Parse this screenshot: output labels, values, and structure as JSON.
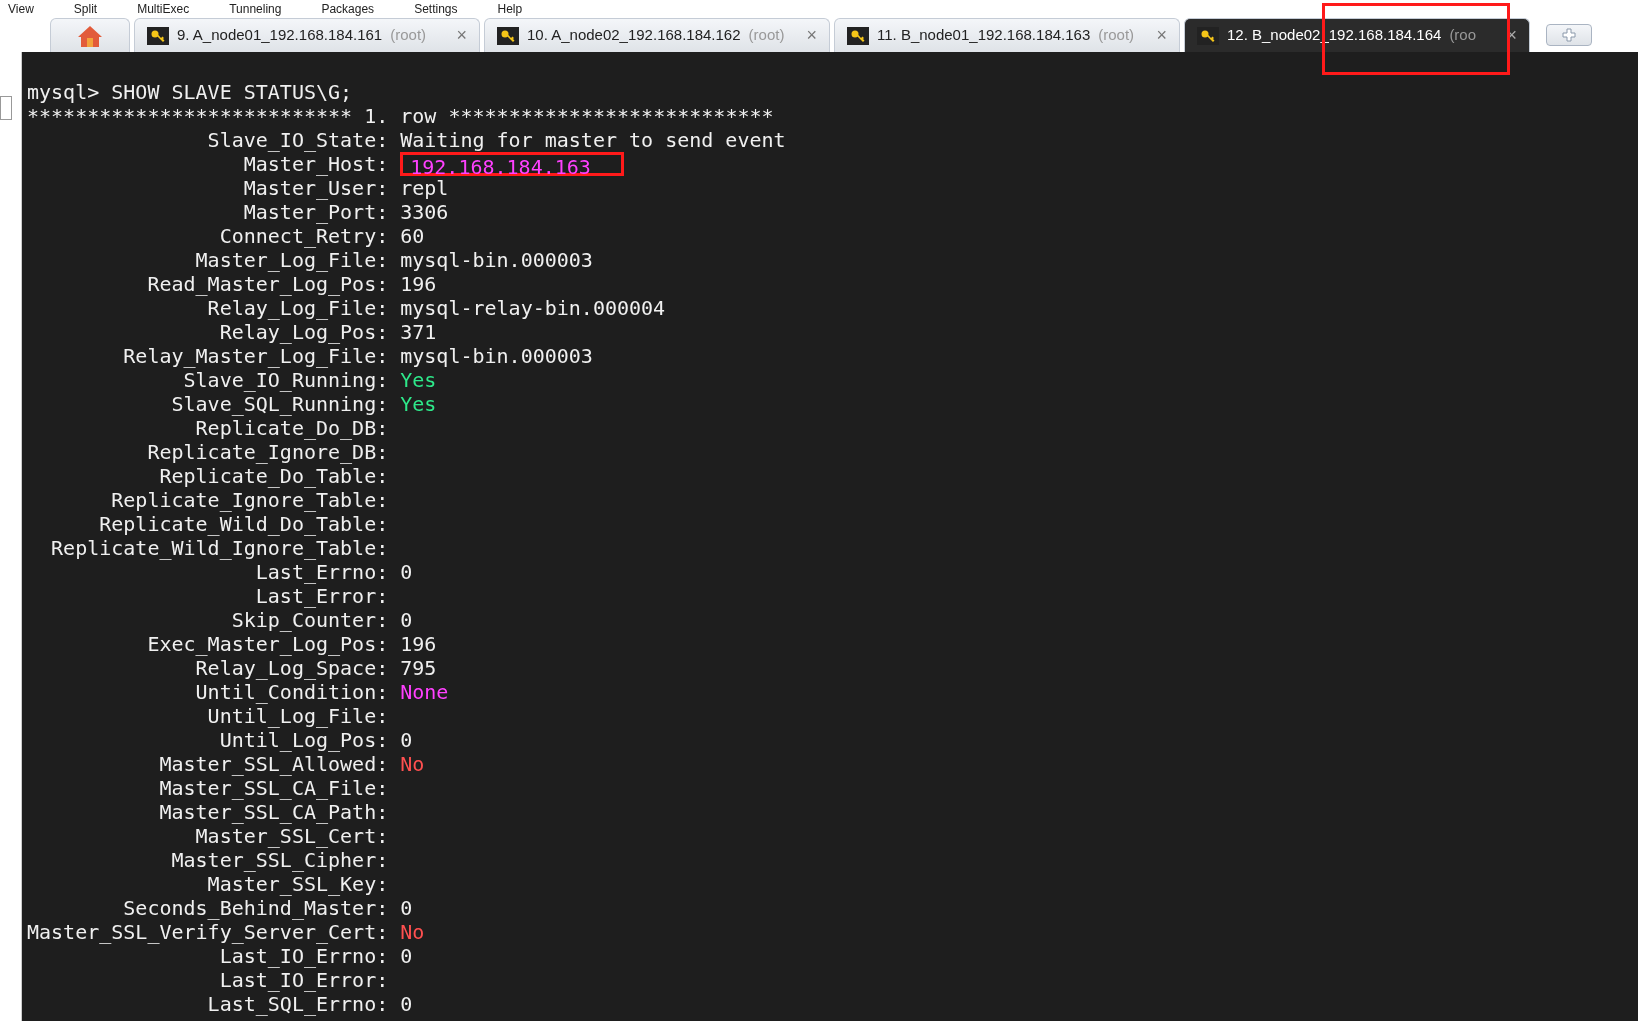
{
  "menu": [
    "View",
    "Split",
    "MultiExec",
    "Tunneling",
    "Packages",
    "Settings",
    "Help"
  ],
  "tabs": [
    {
      "kind": "home",
      "selected": false
    },
    {
      "kind": "session",
      "title": "9. A_node01_192.168.184.161",
      "user": "(root)",
      "close": "×",
      "selected": false
    },
    {
      "kind": "session",
      "title": "10. A_node02_192.168.184.162",
      "user": "(root)",
      "close": "×",
      "selected": false
    },
    {
      "kind": "session",
      "title": "11. B_node01_192.168.184.163",
      "user": "(root)",
      "close": "×",
      "selected": false
    },
    {
      "kind": "session",
      "title": "12. B_node02_192.168.184.164",
      "user": "(roo",
      "close": "×",
      "selected": true
    },
    {
      "kind": "new",
      "selected": false
    }
  ],
  "terminal": {
    "command": "mysql> SHOW SLAVE STATUS\\G;",
    "row_header": "*************************** 1. row ***************************",
    "fields": [
      {
        "name": "Slave_IO_State:",
        "value": "Waiting for master to send event"
      },
      {
        "name": "Master_Host:",
        "value": "192.168.184.163",
        "color": "#ff40ff",
        "highlighted": true
      },
      {
        "name": "Master_User:",
        "value": "repl"
      },
      {
        "name": "Master_Port:",
        "value": "3306"
      },
      {
        "name": "Connect_Retry:",
        "value": "60"
      },
      {
        "name": "Master_Log_File:",
        "value": "mysql-bin.000003"
      },
      {
        "name": "Read_Master_Log_Pos:",
        "value": "196"
      },
      {
        "name": "Relay_Log_File:",
        "value": "mysql-relay-bin.000004"
      },
      {
        "name": "Relay_Log_Pos:",
        "value": "371"
      },
      {
        "name": "Relay_Master_Log_File:",
        "value": "mysql-bin.000003"
      },
      {
        "name": "Slave_IO_Running:",
        "value": "Yes",
        "color": "#2ee88a"
      },
      {
        "name": "Slave_SQL_Running:",
        "value": "Yes",
        "color": "#2ee88a"
      },
      {
        "name": "Replicate_Do_DB:"
      },
      {
        "name": "Replicate_Ignore_DB:"
      },
      {
        "name": "Replicate_Do_Table:"
      },
      {
        "name": "Replicate_Ignore_Table:"
      },
      {
        "name": "Replicate_Wild_Do_Table:"
      },
      {
        "name": "Replicate_Wild_Ignore_Table:"
      },
      {
        "name": "Last_Errno:",
        "value": "0"
      },
      {
        "name": "Last_Error:"
      },
      {
        "name": "Skip_Counter:",
        "value": "0"
      },
      {
        "name": "Exec_Master_Log_Pos:",
        "value": "196"
      },
      {
        "name": "Relay_Log_Space:",
        "value": "795"
      },
      {
        "name": "Until_Condition:",
        "value": "None",
        "color": "#ff40ff"
      },
      {
        "name": "Until_Log_File:"
      },
      {
        "name": "Until_Log_Pos:",
        "value": "0"
      },
      {
        "name": "Master_SSL_Allowed:",
        "value": "No",
        "color": "#ff5050"
      },
      {
        "name": "Master_SSL_CA_File:"
      },
      {
        "name": "Master_SSL_CA_Path:"
      },
      {
        "name": "Master_SSL_Cert:"
      },
      {
        "name": "Master_SSL_Cipher:"
      },
      {
        "name": "Master_SSL_Key:"
      },
      {
        "name": "Seconds_Behind_Master:",
        "value": "0"
      },
      {
        "name": "Master_SSL_Verify_Server_Cert:",
        "value": "No",
        "color": "#ff5050"
      },
      {
        "name": "Last_IO_Errno:",
        "value": "0"
      },
      {
        "name": "Last_IO_Error:"
      },
      {
        "name": "Last_SQL_Errno:",
        "value": "0"
      }
    ]
  }
}
